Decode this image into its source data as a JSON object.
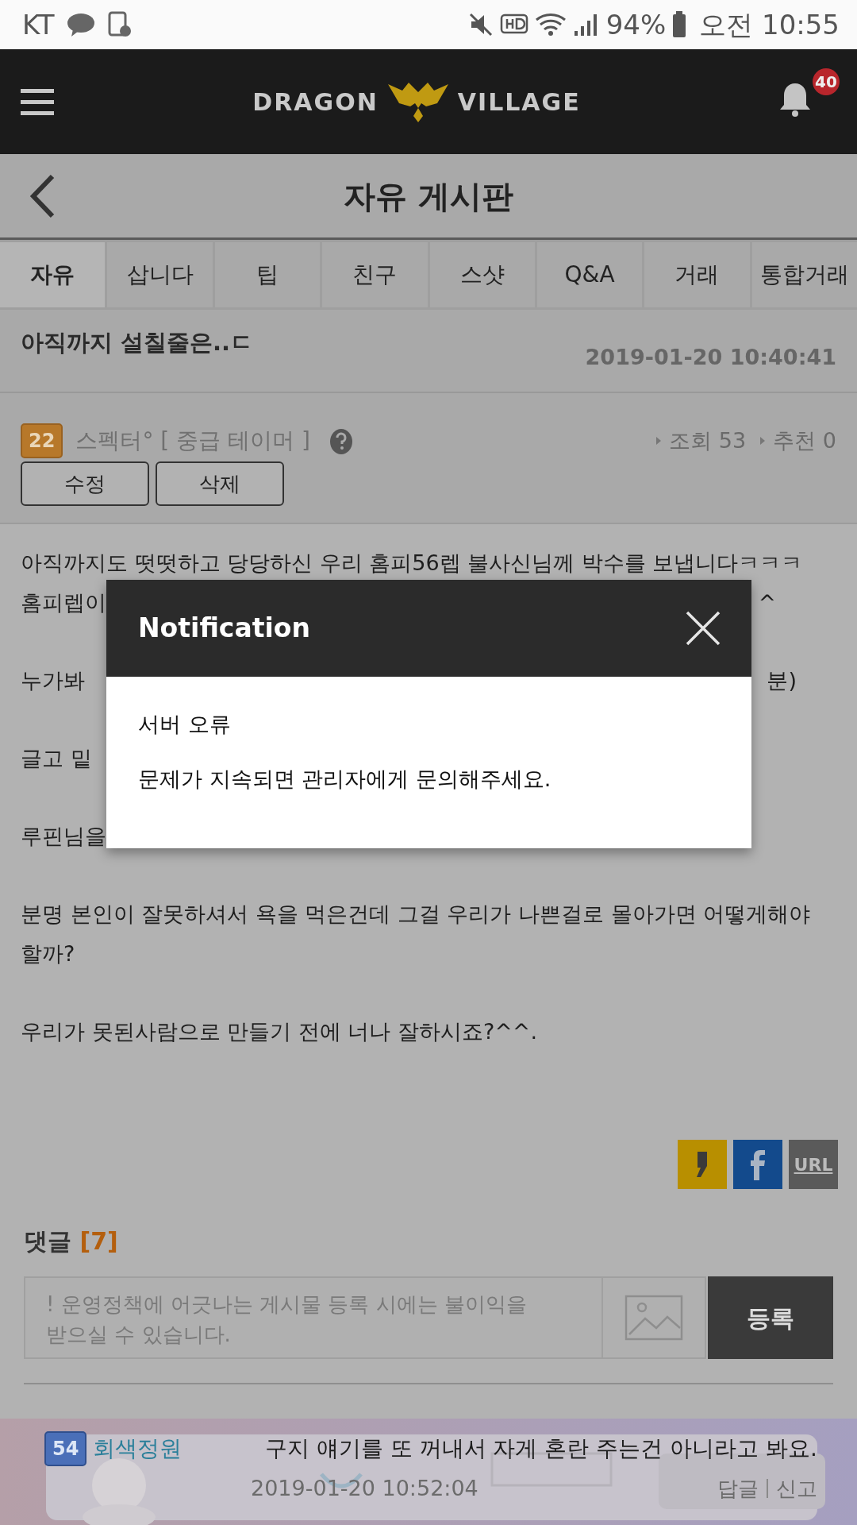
{
  "status_bar": {
    "carrier": "KT",
    "battery": "94%",
    "time": "오전 10:55"
  },
  "header": {
    "logo_left": "DRAGON",
    "logo_right": "VILLAGE",
    "notification_count": "40"
  },
  "board_title": "자유 게시판",
  "tabs": [
    {
      "label": "자유",
      "selected": true
    },
    {
      "label": "삽니다",
      "selected": false
    },
    {
      "label": "팁",
      "selected": false
    },
    {
      "label": "친구",
      "selected": false
    },
    {
      "label": "스샷",
      "selected": false
    },
    {
      "label": "Q&A",
      "selected": false
    },
    {
      "label": "거래",
      "selected": false
    },
    {
      "label": "통합거래",
      "selected": false
    }
  ],
  "post": {
    "title": "아직까지 설칠줄은..ㄷ",
    "date": "2019-01-20 10:40:41",
    "author": {
      "level": "22",
      "name": "스펙터°",
      "rank": "[ 중급 테이머 ]"
    },
    "views": "조회 53",
    "recommends": "추천 0",
    "buttons": [
      "수정",
      "삭제"
    ],
    "paragraphs": [
      [
        {
          "left": "아직까지도 떳떳하고 당당하신 우리 홈피56렙 불사신님께 박수를 보냅니다ㅋㅋㅋ"
        },
        {
          "left": "홈피렙이",
          "right": "^"
        }
      ],
      [
        {
          "left": "누가봐",
          "right": "분)"
        }
      ],
      [
        {
          "left": "글고 밑"
        }
      ],
      [
        {
          "left": "루핀님을"
        }
      ],
      [
        {
          "left": "분명 본인이 잘못하셔서 욕을 먹은건데 그걸 우리가 나쁜걸로 몰아가면 어떻게해야"
        },
        {
          "left": "할까?"
        }
      ],
      [
        {
          "left": "우리가 못된사람으로 만들기 전에 너나 잘하시죠?^^."
        }
      ]
    ]
  },
  "share": [
    {
      "kind": "kakao"
    },
    {
      "kind": "facebook"
    },
    {
      "kind": "url",
      "label": "URL"
    }
  ],
  "comments": {
    "label": "댓글",
    "count": "[7]",
    "placeholder": "! 운영정책에 어긋나는 게시물 등록 시에는 불이익을 받으실 수 있습니다.",
    "submit": "등록"
  },
  "comment": {
    "level": "54",
    "author": "회색정원",
    "text": "구지 얘기를 또 꺼내서 자게 혼란 주는건 아니라고 봐요.",
    "date": "2019-01-20 10:52:04",
    "actions": [
      "답글",
      "신고"
    ]
  },
  "modal": {
    "title": "Notification",
    "lines": [
      "서버 오류",
      "문제가 지속되면 관리자에게 문의해주세요."
    ]
  }
}
